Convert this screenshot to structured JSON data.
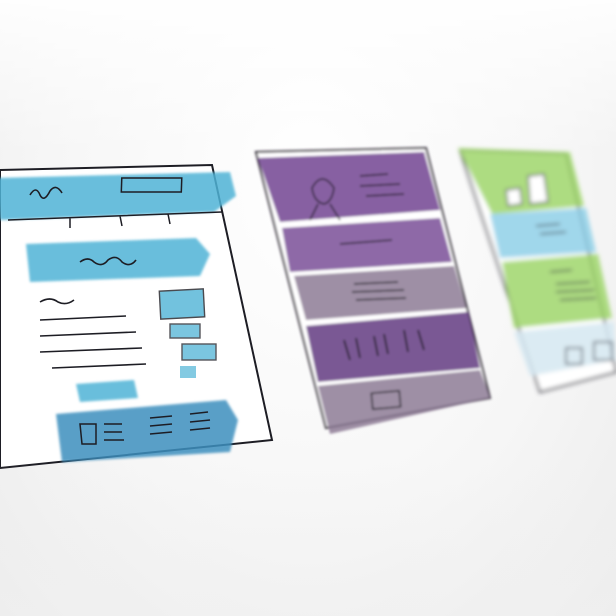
{
  "scene": {
    "description_colors": {
      "blue": "#4fb3d6",
      "purple": "#7a4f98",
      "mauve": "#8d7b95",
      "green": "#9fd66b",
      "ink": "#1d1d24",
      "paper": "#ffffff"
    }
  }
}
